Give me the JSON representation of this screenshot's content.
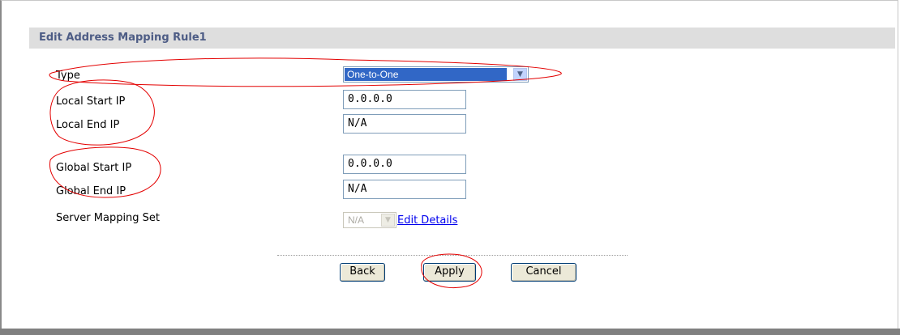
{
  "form": {
    "title": "Edit Address Mapping Rule1",
    "fields": [
      {
        "label": "Type",
        "value": "One-to-One"
      },
      {
        "label": "Local Start IP",
        "value": "0.0.0.0"
      },
      {
        "label": "Local End IP",
        "value": "N/A"
      },
      {
        "label": "Global Start IP",
        "value": "0.0.0.0"
      },
      {
        "label": "Global End IP",
        "value": "N/A"
      },
      {
        "label": "Server Mapping Set",
        "value": "N/A"
      }
    ],
    "edit_details_label": "Edit Details"
  },
  "buttons": {
    "back": "Back",
    "apply": "Apply",
    "cancel": "Cancel"
  },
  "colors": {
    "title_text": "#4d5c85",
    "title_bar": "#dedede",
    "selected_option": "#3167c6",
    "annotation": "#e30000",
    "link": "#0000ee"
  },
  "icons": {
    "dropdown": "chevron-down-icon"
  }
}
